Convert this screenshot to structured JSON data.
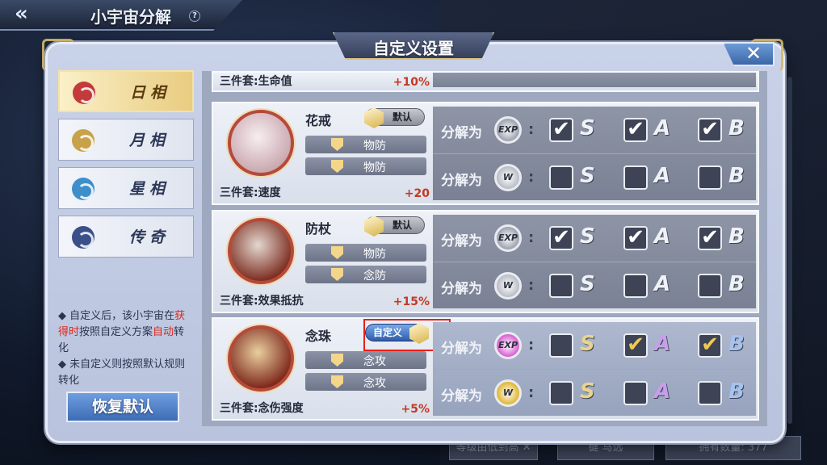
{
  "screen": {
    "title": "小宇宙分解",
    "help": "?",
    "back": "«"
  },
  "dialog": {
    "title": "自定义设置",
    "close": "✕"
  },
  "tabs": [
    {
      "label": "日相",
      "color": "#c23a3a",
      "active": true
    },
    {
      "label": "月相",
      "color": "#c7a24a",
      "active": false
    },
    {
      "label": "星相",
      "color": "#3e8fc9",
      "active": false
    },
    {
      "label": "传奇",
      "color": "#3b4f8a",
      "active": false
    }
  ],
  "notes": {
    "line1_a": "◆ 自定义后，该小宇宙在",
    "line1_red1": "获得时",
    "line1_b": "按照自定义方案",
    "line1_red2": "自动",
    "line1_c": "转化",
    "line2": "◆ 未自定义则按照默认规则转化"
  },
  "restore_button": "恢复默认",
  "partial_row": {
    "set_label": "三件套:生命值",
    "set_value": "+10%"
  },
  "items": [
    {
      "name": "花戒",
      "mode": "默认",
      "mode_type": "default",
      "portrait_colors": [
        "#f7eef0",
        "#c9a6ae"
      ],
      "stats": [
        "物防",
        "物防"
      ],
      "set_label": "三件套:速度",
      "set_value": "+20",
      "active": false,
      "rows": [
        {
          "label": "分解为",
          "icon": "EXP",
          "icon_color": "#9aa0ad",
          "checks": [
            true,
            true,
            true
          ]
        },
        {
          "label": "分解为",
          "icon": "W",
          "icon_color": "#b8bcc6",
          "checks": [
            false,
            false,
            false
          ]
        }
      ]
    },
    {
      "name": "防杖",
      "mode": "默认",
      "mode_type": "default",
      "portrait_colors": [
        "#e3d8cf",
        "#7b2a1e"
      ],
      "stats": [
        "物防",
        "念防"
      ],
      "set_label": "三件套:效果抵抗",
      "set_value": "+15%",
      "active": false,
      "rows": [
        {
          "label": "分解为",
          "icon": "EXP",
          "icon_color": "#9aa0ad",
          "checks": [
            true,
            true,
            true
          ]
        },
        {
          "label": "分解为",
          "icon": "W",
          "icon_color": "#b8bcc6",
          "checks": [
            false,
            false,
            false
          ]
        }
      ]
    },
    {
      "name": "念珠",
      "mode": "自定义",
      "mode_type": "custom",
      "portrait_colors": [
        "#e9cfa0",
        "#7b2418"
      ],
      "stats": [
        "念攻",
        "念攻"
      ],
      "set_label": "三件套:念伤强度",
      "set_value": "+5%",
      "active": true,
      "rows": [
        {
          "label": "分解为",
          "icon": "EXP",
          "icon_color": "#d65fd0",
          "checks": [
            false,
            true,
            true
          ]
        },
        {
          "label": "分解为",
          "icon": "W",
          "icon_color": "#e0b531",
          "checks": [
            false,
            false,
            false
          ]
        }
      ]
    }
  ],
  "grades": [
    "S",
    "A",
    "B"
  ],
  "background": {
    "btn1": "等级由低到高 ✕",
    "btn2": "键 马远",
    "btn3": "拥有数量: 377"
  }
}
